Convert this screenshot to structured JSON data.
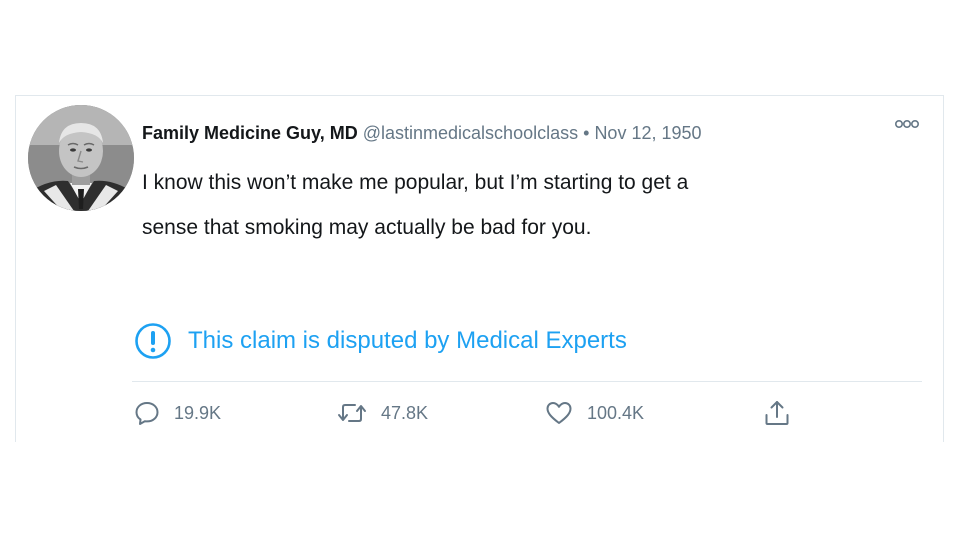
{
  "tweet": {
    "author": {
      "display_name": "Family Medicine Guy, MD",
      "handle": "@lastinmedicalschoolclass"
    },
    "separator": "•",
    "date": "Nov 12, 1950",
    "text_line1": "I know this won’t make me popular, but I’m starting to get a",
    "text_line2": "sense that smoking may actually be bad for you.",
    "dispute_notice": "This claim is disputed by Medical Experts",
    "actions": {
      "reply_count": "19.9K",
      "retweet_count": "47.8K",
      "like_count": "100.4K"
    },
    "icons": {
      "more": "more-options-icon",
      "dispute": "exclamation-circle-icon",
      "reply": "reply-icon",
      "retweet": "retweet-icon",
      "like": "heart-icon",
      "share": "share-icon"
    }
  },
  "colors": {
    "accent": "#1da1f2",
    "secondary_text": "#657786",
    "primary_text": "#14171a",
    "border": "#e1e8ed"
  }
}
